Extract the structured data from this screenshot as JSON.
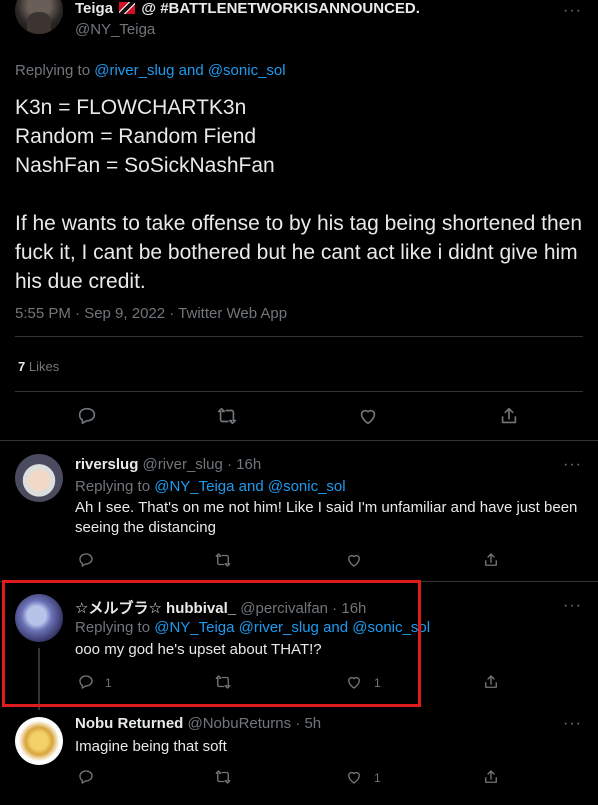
{
  "main_tweet": {
    "display_name": "Teiga",
    "name_suffix": "@ #BATTLENETWORKISANNOUNCED.",
    "handle": "@NY_Teiga",
    "more": "···",
    "replying_prefix": "Replying to",
    "replying_to": "@river_slug and @sonic_sol",
    "lines": [
      "K3n = FLOWCHARTK3n",
      "Random = Random Fiend",
      "NashFan = SoSickNashFan",
      "",
      "If he wants to take offense to by his tag being shortened then fuck it, I cant be bothered but he cant act like i didnt give him his due credit."
    ],
    "meta": "5:55 PM · Sep 9, 2022 · Twitter Web App",
    "likes_count": "7",
    "likes_label": "Likes"
  },
  "replies": [
    {
      "name": "riverslug",
      "handle": "@river_slug · 16h",
      "replying_prefix": "Replying to",
      "replying_to": "@NY_Teiga and @sonic_sol",
      "text": "Ah I see. That's on me not him! Like I said I'm unfamiliar and have just been seeing the distancing",
      "reply_count": "",
      "like_count": ""
    },
    {
      "name": "☆メルブラ☆ hubbival_",
      "handle": "@percivalfan · 16h",
      "replying_prefix": "Replying to",
      "replying_to": "@NY_Teiga @river_slug and @sonic_sol",
      "text": "ooo my god  he's upset about THAT!?",
      "reply_count": "1",
      "like_count": "1"
    },
    {
      "name": "Nobu Returned",
      "handle": "@NobuReturns · 5h",
      "text": "Imagine being that soft",
      "reply_count": "",
      "like_count": "1"
    }
  ],
  "colors": {
    "background": "#000000",
    "text": "#e7e9ea",
    "muted": "#71767b",
    "link": "#1d9bf0",
    "highlight": "#e01b1b"
  },
  "icons": [
    "reply-icon",
    "retweet-icon",
    "like-icon",
    "share-icon",
    "more-icon"
  ]
}
